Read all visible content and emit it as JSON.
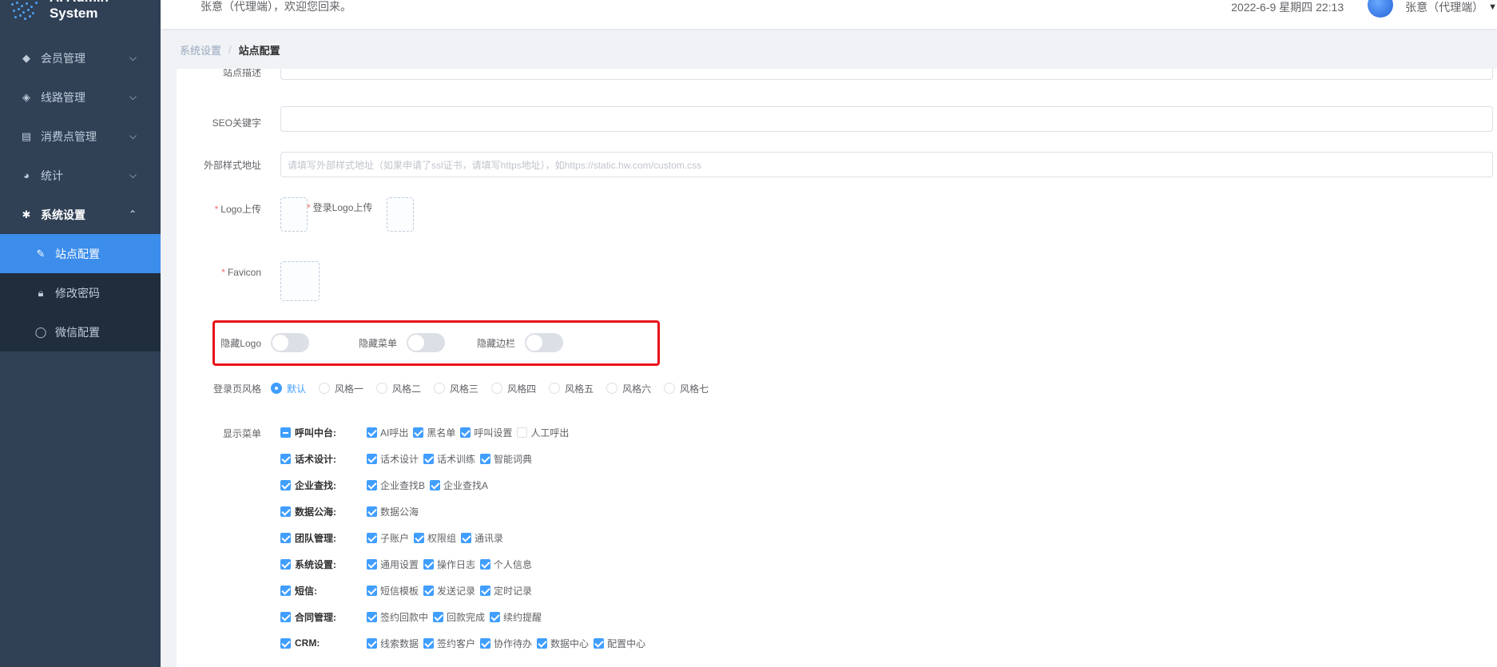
{
  "app": {
    "title": "AI Admin System"
  },
  "header": {
    "welcome": "张意（代理端），欢迎您回来。",
    "datetime": "2022-6-9 星期四 22:13",
    "username": "张意（代理端）"
  },
  "sidebar": {
    "items": [
      {
        "label": "会员管理",
        "icon": "diamond-icon"
      },
      {
        "label": "线路管理",
        "icon": "route-icon"
      },
      {
        "label": "消费点管理",
        "icon": "receipt-icon"
      },
      {
        "label": "统计",
        "icon": "pie-chart-icon"
      },
      {
        "label": "系统设置",
        "icon": "gear-icon"
      }
    ],
    "subitems": [
      {
        "label": "站点配置",
        "icon": "site-config-icon"
      },
      {
        "label": "修改密码",
        "icon": "lock-icon"
      },
      {
        "label": "微信配置",
        "icon": "chat-bubble-icon"
      }
    ]
  },
  "breadcrumb": {
    "parent": "系统设置",
    "current": "站点配置"
  },
  "form": {
    "site_desc_label": "站点描述",
    "seo_label": "SEO关键字",
    "css_label": "外部样式地址",
    "css_placeholder": "请填写外部样式地址（如果申请了ssl证书，请填写https地址），如https://static.hw.com/custom.css",
    "logo_label": "Logo上传",
    "login_logo_label": "登录Logo上传",
    "favicon_label": "Favicon",
    "hide_logo_label": "隐藏Logo",
    "hide_menu_label": "隐藏菜单",
    "hide_sidebar_label": "隐藏边栏",
    "login_style_label": "登录页风格",
    "login_styles": [
      "默认",
      "风格一",
      "风格二",
      "风格三",
      "风格四",
      "风格五",
      "风格六",
      "风格七"
    ],
    "login_style_selected": "默认",
    "show_menu_label": "显示菜单"
  },
  "menu_groups": [
    {
      "name": "呼叫中台:",
      "state": "indeterminate",
      "items": [
        {
          "label": "AI呼出",
          "checked": true
        },
        {
          "label": "黑名单",
          "checked": true
        },
        {
          "label": "呼叫设置",
          "checked": true
        },
        {
          "label": "人工呼出",
          "checked": false
        }
      ]
    },
    {
      "name": "话术设计:",
      "state": "checked",
      "items": [
        {
          "label": "话术设计",
          "checked": true
        },
        {
          "label": "话术训练",
          "checked": true
        },
        {
          "label": "智能词典",
          "checked": true
        }
      ]
    },
    {
      "name": "企业查找:",
      "state": "checked",
      "items": [
        {
          "label": "企业查找B",
          "checked": true
        },
        {
          "label": "企业查找A",
          "checked": true
        }
      ]
    },
    {
      "name": "数据公海:",
      "state": "checked",
      "items": [
        {
          "label": "数据公海",
          "checked": true
        }
      ]
    },
    {
      "name": "团队管理:",
      "state": "checked",
      "items": [
        {
          "label": "子账户",
          "checked": true
        },
        {
          "label": "权限组",
          "checked": true
        },
        {
          "label": "通讯录",
          "checked": true
        }
      ]
    },
    {
      "name": "系统设置:",
      "state": "checked",
      "items": [
        {
          "label": "通用设置",
          "checked": true
        },
        {
          "label": "操作日志",
          "checked": true
        },
        {
          "label": "个人信息",
          "checked": true
        }
      ]
    },
    {
      "name": "短信:",
      "state": "checked",
      "items": [
        {
          "label": "短信模板",
          "checked": true
        },
        {
          "label": "发送记录",
          "checked": true
        },
        {
          "label": "定时记录",
          "checked": true
        }
      ]
    },
    {
      "name": "合同管理:",
      "state": "checked",
      "items": [
        {
          "label": "签约回款中",
          "checked": true
        },
        {
          "label": "回款完成",
          "checked": true
        },
        {
          "label": "续约提醒",
          "checked": true
        }
      ]
    },
    {
      "name": "CRM:",
      "state": "checked",
      "items": [
        {
          "label": "线索数据",
          "checked": true
        },
        {
          "label": "签约客户",
          "checked": true
        },
        {
          "label": "协作待办",
          "checked": true
        },
        {
          "label": "数据中心",
          "checked": true
        },
        {
          "label": "配置中心",
          "checked": true
        }
      ]
    }
  ],
  "colors": {
    "sidebar_bg": "#304156",
    "active": "#3c8dec",
    "primary": "#409eff",
    "highlight_border": "#e8111a"
  }
}
